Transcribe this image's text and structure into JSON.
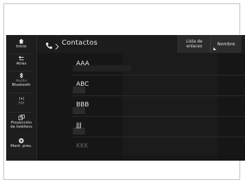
{
  "sidebar": {
    "items": [
      {
        "label": "Inicio",
        "icon": "home-icon"
      },
      {
        "label": "Atrás",
        "icon": "back-icon"
      },
      {
        "label": "Audio",
        "label2": "Bluetooth",
        "icon": "bluetooth-icon"
      },
      {
        "label": "FM",
        "icon": "radio-icon"
      },
      {
        "label": "Proyección",
        "label2": "de teléfono",
        "icon": "phone-projection-icon"
      },
      {
        "label": "Mant. pres.",
        "icon": "plus-icon"
      }
    ]
  },
  "header": {
    "title": "Contactos",
    "links_button": "Lista de enlaces",
    "name_button": "Nombre"
  },
  "contacts": [
    "AAA",
    "ABC",
    "BBB",
    "JJJ",
    "KKK"
  ],
  "colors": {
    "background": "#161616",
    "text": "#ececec",
    "accent": "#ffffff"
  }
}
